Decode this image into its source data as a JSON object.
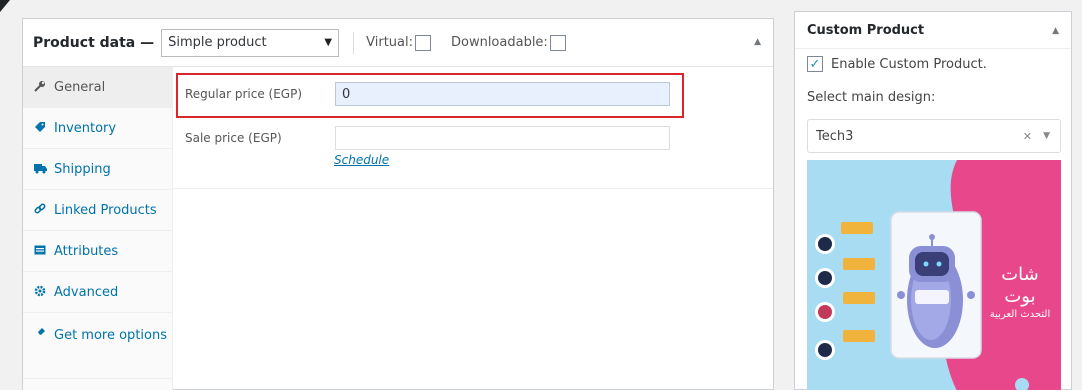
{
  "product_data": {
    "title": "Product data —",
    "product_type": "Simple product",
    "virtual_label": "Virtual:",
    "downloadable_label": "Downloadable:",
    "tabs": [
      {
        "label": "General",
        "icon": "wrench-icon"
      },
      {
        "label": "Inventory",
        "icon": "tag-icon"
      },
      {
        "label": "Shipping",
        "icon": "truck-icon"
      },
      {
        "label": "Linked Products",
        "icon": "link-icon"
      },
      {
        "label": "Attributes",
        "icon": "table-icon"
      },
      {
        "label": "Advanced",
        "icon": "gear-icon"
      },
      {
        "label": "Get more options",
        "icon": "plugin-icon"
      }
    ],
    "regular_price_label": "Regular price (EGP)",
    "regular_price_value": "0",
    "sale_price_label": "Sale price (EGP)",
    "sale_price_value": "",
    "schedule_link": "Schedule"
  },
  "custom_product": {
    "title": "Custom Product",
    "enable_label": "Enable Custom Product.",
    "enable_checked": true,
    "select_label": "Select main design:",
    "selected_design": "Tech3",
    "preview_title_ar": "شات بوت",
    "preview_subtitle_ar": "التحدث العربية"
  },
  "colors": {
    "accent": "#0073aa",
    "highlight_frame": "#d9262c",
    "preview_pink": "#e9478b",
    "preview_blue": "#a8dcf2"
  }
}
